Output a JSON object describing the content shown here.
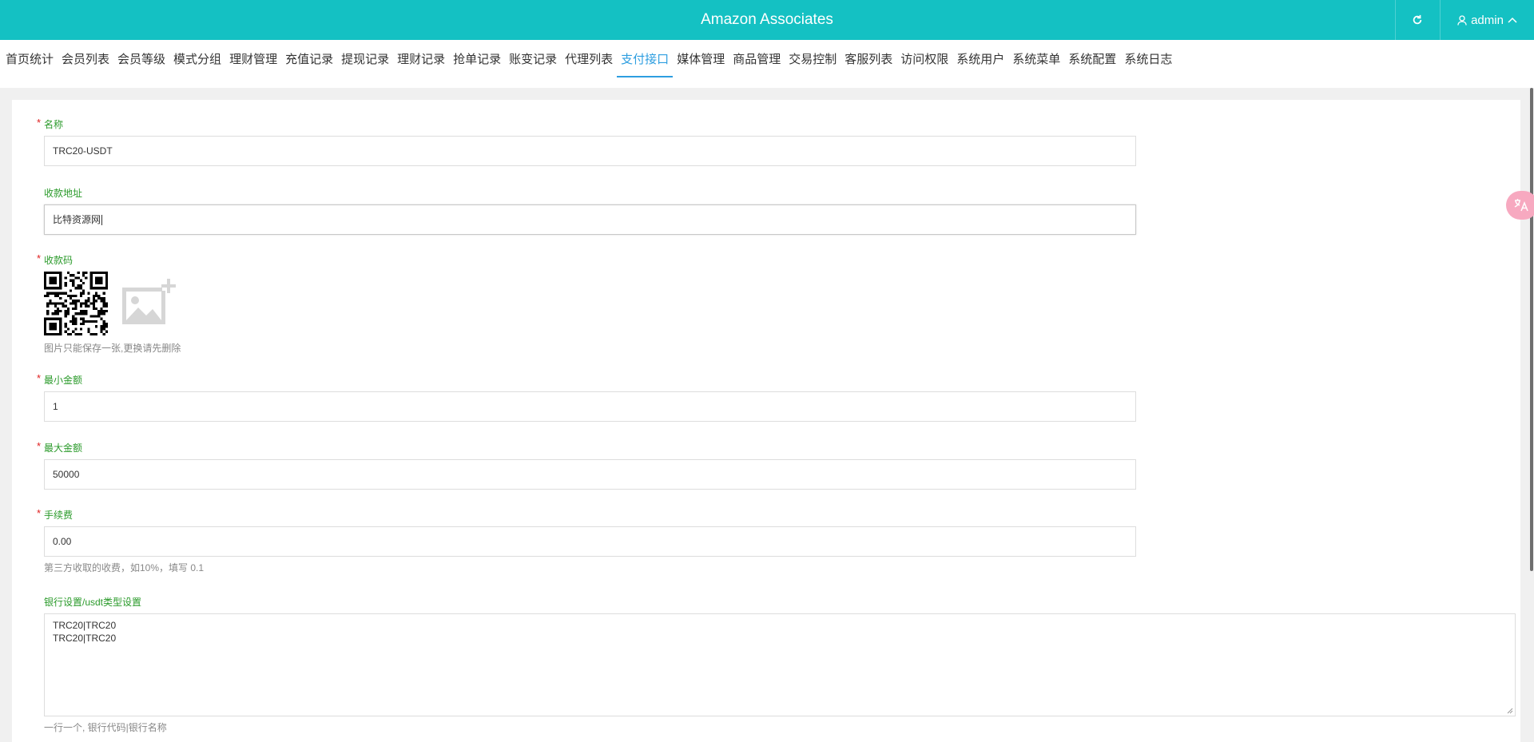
{
  "header": {
    "title": "Amazon Associates",
    "user": "admin"
  },
  "nav": {
    "items": [
      "首页统计",
      "会员列表",
      "会员等级",
      "模式分组",
      "理财管理",
      "充值记录",
      "提现记录",
      "理财记录",
      "抢单记录",
      "账变记录",
      "代理列表",
      "支付接口",
      "媒体管理",
      "商品管理",
      "交易控制",
      "客服列表",
      "访问权限",
      "系统用户",
      "系统菜单",
      "系统配置",
      "系统日志"
    ],
    "active": "支付接口"
  },
  "form": {
    "name": {
      "label": "名称",
      "value": "TRC20-USDT"
    },
    "address": {
      "label": "收款地址",
      "value": "比特资源网"
    },
    "qrcode": {
      "label": "收款码",
      "help": "图片只能保存一张,更换请先删除"
    },
    "min_amount": {
      "label": "最小金额",
      "value": "1"
    },
    "max_amount": {
      "label": "最大金额",
      "value": "50000"
    },
    "fee": {
      "label": "手续费",
      "value": "0.00",
      "help": "第三方收取的收费，如10%，填写 0.1"
    },
    "bank": {
      "label": "银行设置/usdt类型设置",
      "lines": [
        "TRC20|TRC20",
        "TRC20|TRC20"
      ],
      "help": "一行一个, 银行代码|银行名称"
    }
  },
  "colors": {
    "header": "#14c1c3",
    "active_tab": "#2d9ee0",
    "label": "#2a9a2a",
    "required": "#e02020"
  }
}
